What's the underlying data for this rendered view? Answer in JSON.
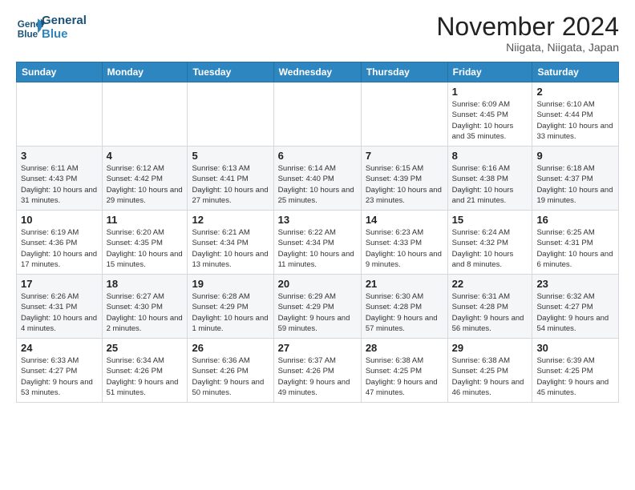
{
  "header": {
    "logo_line1": "General",
    "logo_line2": "Blue",
    "month_title": "November 2024",
    "location": "Niigata, Niigata, Japan"
  },
  "weekdays": [
    "Sunday",
    "Monday",
    "Tuesday",
    "Wednesday",
    "Thursday",
    "Friday",
    "Saturday"
  ],
  "weeks": [
    [
      {
        "day": "",
        "info": ""
      },
      {
        "day": "",
        "info": ""
      },
      {
        "day": "",
        "info": ""
      },
      {
        "day": "",
        "info": ""
      },
      {
        "day": "",
        "info": ""
      },
      {
        "day": "1",
        "info": "Sunrise: 6:09 AM\nSunset: 4:45 PM\nDaylight: 10 hours and 35 minutes."
      },
      {
        "day": "2",
        "info": "Sunrise: 6:10 AM\nSunset: 4:44 PM\nDaylight: 10 hours and 33 minutes."
      }
    ],
    [
      {
        "day": "3",
        "info": "Sunrise: 6:11 AM\nSunset: 4:43 PM\nDaylight: 10 hours and 31 minutes."
      },
      {
        "day": "4",
        "info": "Sunrise: 6:12 AM\nSunset: 4:42 PM\nDaylight: 10 hours and 29 minutes."
      },
      {
        "day": "5",
        "info": "Sunrise: 6:13 AM\nSunset: 4:41 PM\nDaylight: 10 hours and 27 minutes."
      },
      {
        "day": "6",
        "info": "Sunrise: 6:14 AM\nSunset: 4:40 PM\nDaylight: 10 hours and 25 minutes."
      },
      {
        "day": "7",
        "info": "Sunrise: 6:15 AM\nSunset: 4:39 PM\nDaylight: 10 hours and 23 minutes."
      },
      {
        "day": "8",
        "info": "Sunrise: 6:16 AM\nSunset: 4:38 PM\nDaylight: 10 hours and 21 minutes."
      },
      {
        "day": "9",
        "info": "Sunrise: 6:18 AM\nSunset: 4:37 PM\nDaylight: 10 hours and 19 minutes."
      }
    ],
    [
      {
        "day": "10",
        "info": "Sunrise: 6:19 AM\nSunset: 4:36 PM\nDaylight: 10 hours and 17 minutes."
      },
      {
        "day": "11",
        "info": "Sunrise: 6:20 AM\nSunset: 4:35 PM\nDaylight: 10 hours and 15 minutes."
      },
      {
        "day": "12",
        "info": "Sunrise: 6:21 AM\nSunset: 4:34 PM\nDaylight: 10 hours and 13 minutes."
      },
      {
        "day": "13",
        "info": "Sunrise: 6:22 AM\nSunset: 4:34 PM\nDaylight: 10 hours and 11 minutes."
      },
      {
        "day": "14",
        "info": "Sunrise: 6:23 AM\nSunset: 4:33 PM\nDaylight: 10 hours and 9 minutes."
      },
      {
        "day": "15",
        "info": "Sunrise: 6:24 AM\nSunset: 4:32 PM\nDaylight: 10 hours and 8 minutes."
      },
      {
        "day": "16",
        "info": "Sunrise: 6:25 AM\nSunset: 4:31 PM\nDaylight: 10 hours and 6 minutes."
      }
    ],
    [
      {
        "day": "17",
        "info": "Sunrise: 6:26 AM\nSunset: 4:31 PM\nDaylight: 10 hours and 4 minutes."
      },
      {
        "day": "18",
        "info": "Sunrise: 6:27 AM\nSunset: 4:30 PM\nDaylight: 10 hours and 2 minutes."
      },
      {
        "day": "19",
        "info": "Sunrise: 6:28 AM\nSunset: 4:29 PM\nDaylight: 10 hours and 1 minute."
      },
      {
        "day": "20",
        "info": "Sunrise: 6:29 AM\nSunset: 4:29 PM\nDaylight: 9 hours and 59 minutes."
      },
      {
        "day": "21",
        "info": "Sunrise: 6:30 AM\nSunset: 4:28 PM\nDaylight: 9 hours and 57 minutes."
      },
      {
        "day": "22",
        "info": "Sunrise: 6:31 AM\nSunset: 4:28 PM\nDaylight: 9 hours and 56 minutes."
      },
      {
        "day": "23",
        "info": "Sunrise: 6:32 AM\nSunset: 4:27 PM\nDaylight: 9 hours and 54 minutes."
      }
    ],
    [
      {
        "day": "24",
        "info": "Sunrise: 6:33 AM\nSunset: 4:27 PM\nDaylight: 9 hours and 53 minutes."
      },
      {
        "day": "25",
        "info": "Sunrise: 6:34 AM\nSunset: 4:26 PM\nDaylight: 9 hours and 51 minutes."
      },
      {
        "day": "26",
        "info": "Sunrise: 6:36 AM\nSunset: 4:26 PM\nDaylight: 9 hours and 50 minutes."
      },
      {
        "day": "27",
        "info": "Sunrise: 6:37 AM\nSunset: 4:26 PM\nDaylight: 9 hours and 49 minutes."
      },
      {
        "day": "28",
        "info": "Sunrise: 6:38 AM\nSunset: 4:25 PM\nDaylight: 9 hours and 47 minutes."
      },
      {
        "day": "29",
        "info": "Sunrise: 6:38 AM\nSunset: 4:25 PM\nDaylight: 9 hours and 46 minutes."
      },
      {
        "day": "30",
        "info": "Sunrise: 6:39 AM\nSunset: 4:25 PM\nDaylight: 9 hours and 45 minutes."
      }
    ]
  ]
}
